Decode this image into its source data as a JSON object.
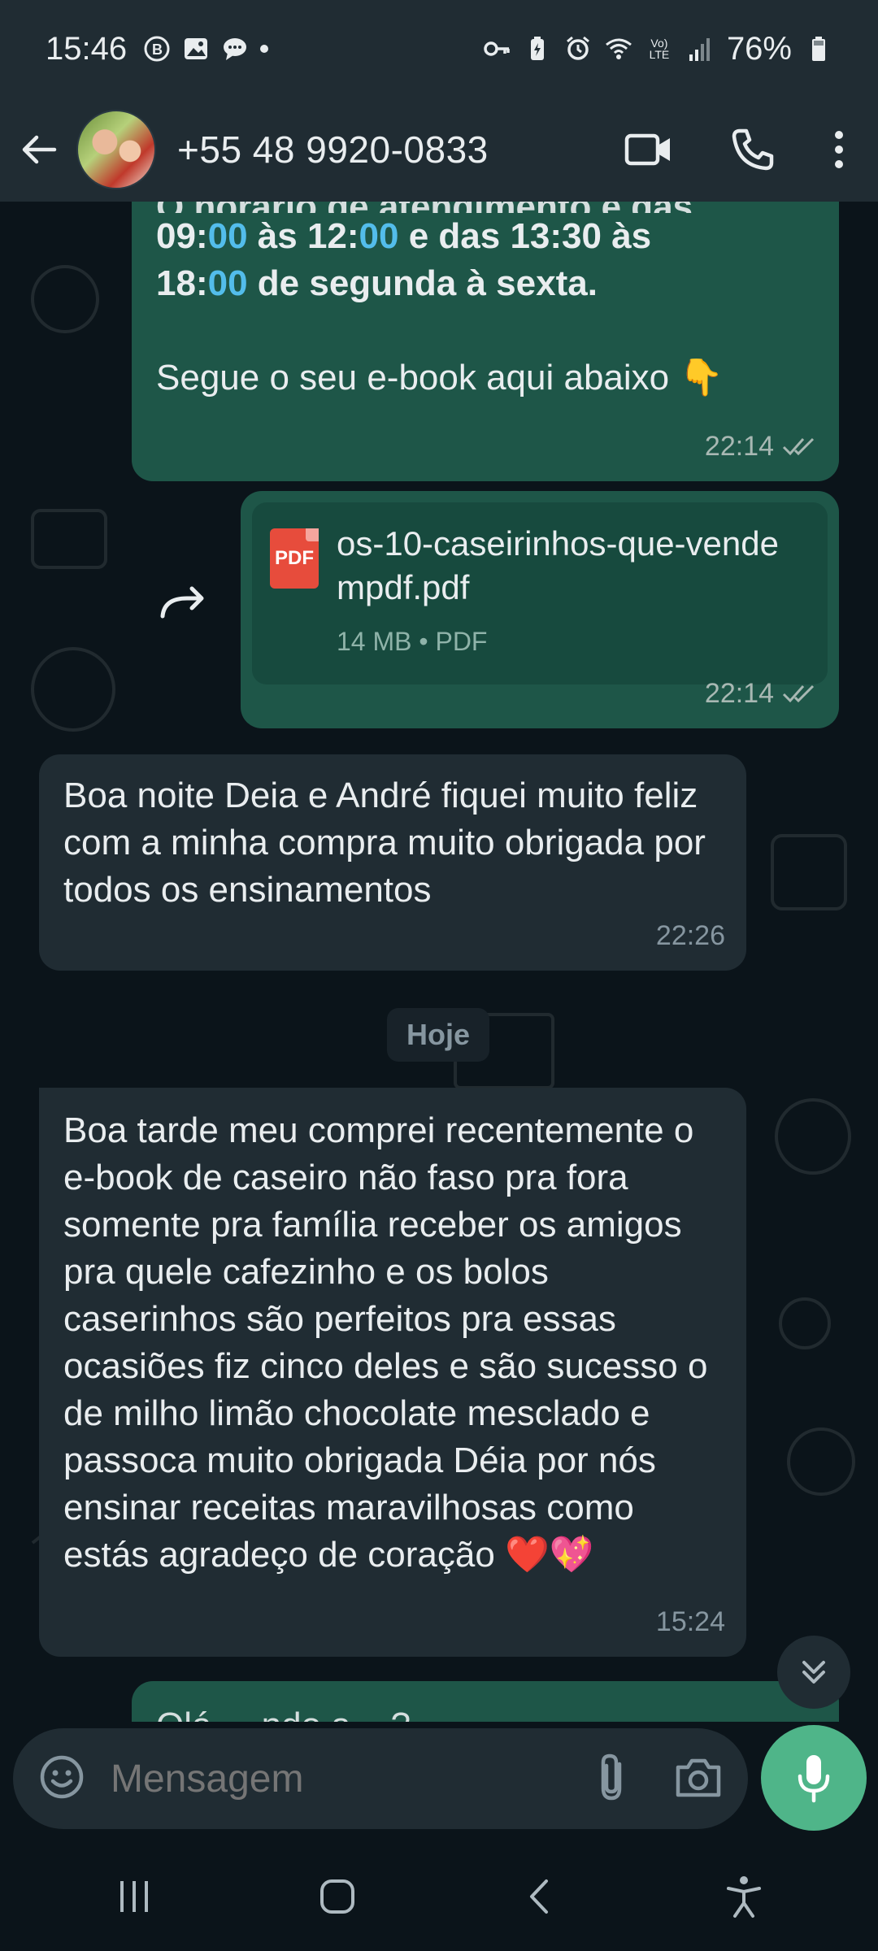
{
  "status_bar": {
    "time": "15:46",
    "battery": "76%",
    "network": "Vo) LTE"
  },
  "header": {
    "contact": "+55 48 9920-0833"
  },
  "messages": {
    "m1": {
      "cut_line": "O horário de atendimento é das",
      "line1_a": "09:",
      "line1_b": "00",
      "line1_c": " às 12:",
      "line1_d": "00",
      "line1_e": " e das 13:30 às",
      "line2_a": "18:",
      "line2_b": "00",
      "line2_c": " de segunda à sexta.",
      "text": "Segue o seu e-book aqui abaixo",
      "emoji": "👇",
      "time": "22:14"
    },
    "m2": {
      "file_name": "os-10-caseirinhos-que-vendempdf.pdf",
      "file_size": "14 MB",
      "file_type": "PDF",
      "file_badge": "PDF",
      "time": "22:14"
    },
    "m3": {
      "text": "Boa noite Deia e André fiquei muito feliz com a minha compra muito obrigada por todos os ensinamentos",
      "time": "22:26"
    },
    "date_chip": "Hoje",
    "m4": {
      "text": "Boa tarde meu comprei recentemente o e-book de caseiro não faso pra fora somente pra família receber os amigos pra quele cafezinho e os bolos caserinhos são perfeitos pra essas ocasiões fiz cinco deles e são sucesso o de milho limão chocolate mesclado e passoca muito obrigada Déia por nós ensinar receitas maravilhosas como estás agradeço de coração",
      "emoji": "❤️💖",
      "time": "15:24"
    },
    "m5": {
      "text": "Olá, ...ndo a ...?"
    }
  },
  "input": {
    "placeholder": "Mensagem"
  },
  "colors": {
    "header_bg": "#202c33",
    "chat_bg": "#0b141a",
    "outgoing_bubble": "#1e5648",
    "incoming_bubble": "#202c33",
    "accent_blue": "#53bdeb",
    "mic_button": "#4fb589"
  }
}
